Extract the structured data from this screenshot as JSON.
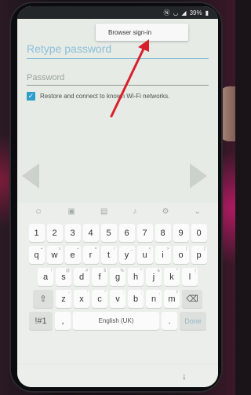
{
  "status_bar": {
    "icons": [
      "nfc-icon",
      "wifi-icon",
      "signal-icon",
      "battery-icon"
    ],
    "battery_text": "39%"
  },
  "menu_popup": {
    "item_label": "Browser sign-in"
  },
  "form": {
    "retype_password_label": "Retype password",
    "password_label": "Password",
    "checkbox_checked": true,
    "checkbox_label": "Restore and connect to known Wi-Fi networks."
  },
  "keyboard": {
    "toolbar_icons": [
      "emoji-icon",
      "sticker-icon",
      "gif-icon",
      "mic-icon",
      "settings-icon",
      "chevron-down-icon"
    ],
    "row_numbers": [
      "1",
      "2",
      "3",
      "4",
      "5",
      "6",
      "7",
      "8",
      "9",
      "0"
    ],
    "row1": [
      {
        "k": "q",
        "s": "+"
      },
      {
        "k": "w",
        "s": "x"
      },
      {
        "k": "e",
        "s": "÷"
      },
      {
        "k": "r",
        "s": "="
      },
      {
        "k": "t",
        "s": "/"
      },
      {
        "k": "y",
        "s": "_"
      },
      {
        "k": "u",
        "s": "<"
      },
      {
        "k": "i",
        "s": ">"
      },
      {
        "k": "o",
        "s": "["
      },
      {
        "k": "p",
        "s": "]"
      }
    ],
    "row2": [
      {
        "k": "a",
        "s": "!"
      },
      {
        "k": "s",
        "s": "@"
      },
      {
        "k": "d",
        "s": "#"
      },
      {
        "k": "f",
        "s": "$"
      },
      {
        "k": "g",
        "s": "%"
      },
      {
        "k": "h",
        "s": "^"
      },
      {
        "k": "j",
        "s": "&"
      },
      {
        "k": "k",
        "s": "*"
      },
      {
        "k": "l",
        "s": "("
      }
    ],
    "row3": [
      {
        "k": "z",
        "s": "-"
      },
      {
        "k": "x",
        "s": "'"
      },
      {
        "k": "c",
        "s": "\""
      },
      {
        "k": "v",
        "s": ":"
      },
      {
        "k": "b",
        "s": ";"
      },
      {
        "k": "n",
        "s": ","
      },
      {
        "k": "m",
        "s": "?"
      }
    ],
    "shift_glyph": "⇧",
    "backspace_glyph": "⌫",
    "symbols_label": "!#1",
    "comma_label": ",",
    "space_label": "English (UK)",
    "period_label": ".",
    "done_label": "Done"
  },
  "nav_bar": {
    "back_glyph": "↓"
  },
  "annotation": {
    "color": "#d8202c"
  }
}
